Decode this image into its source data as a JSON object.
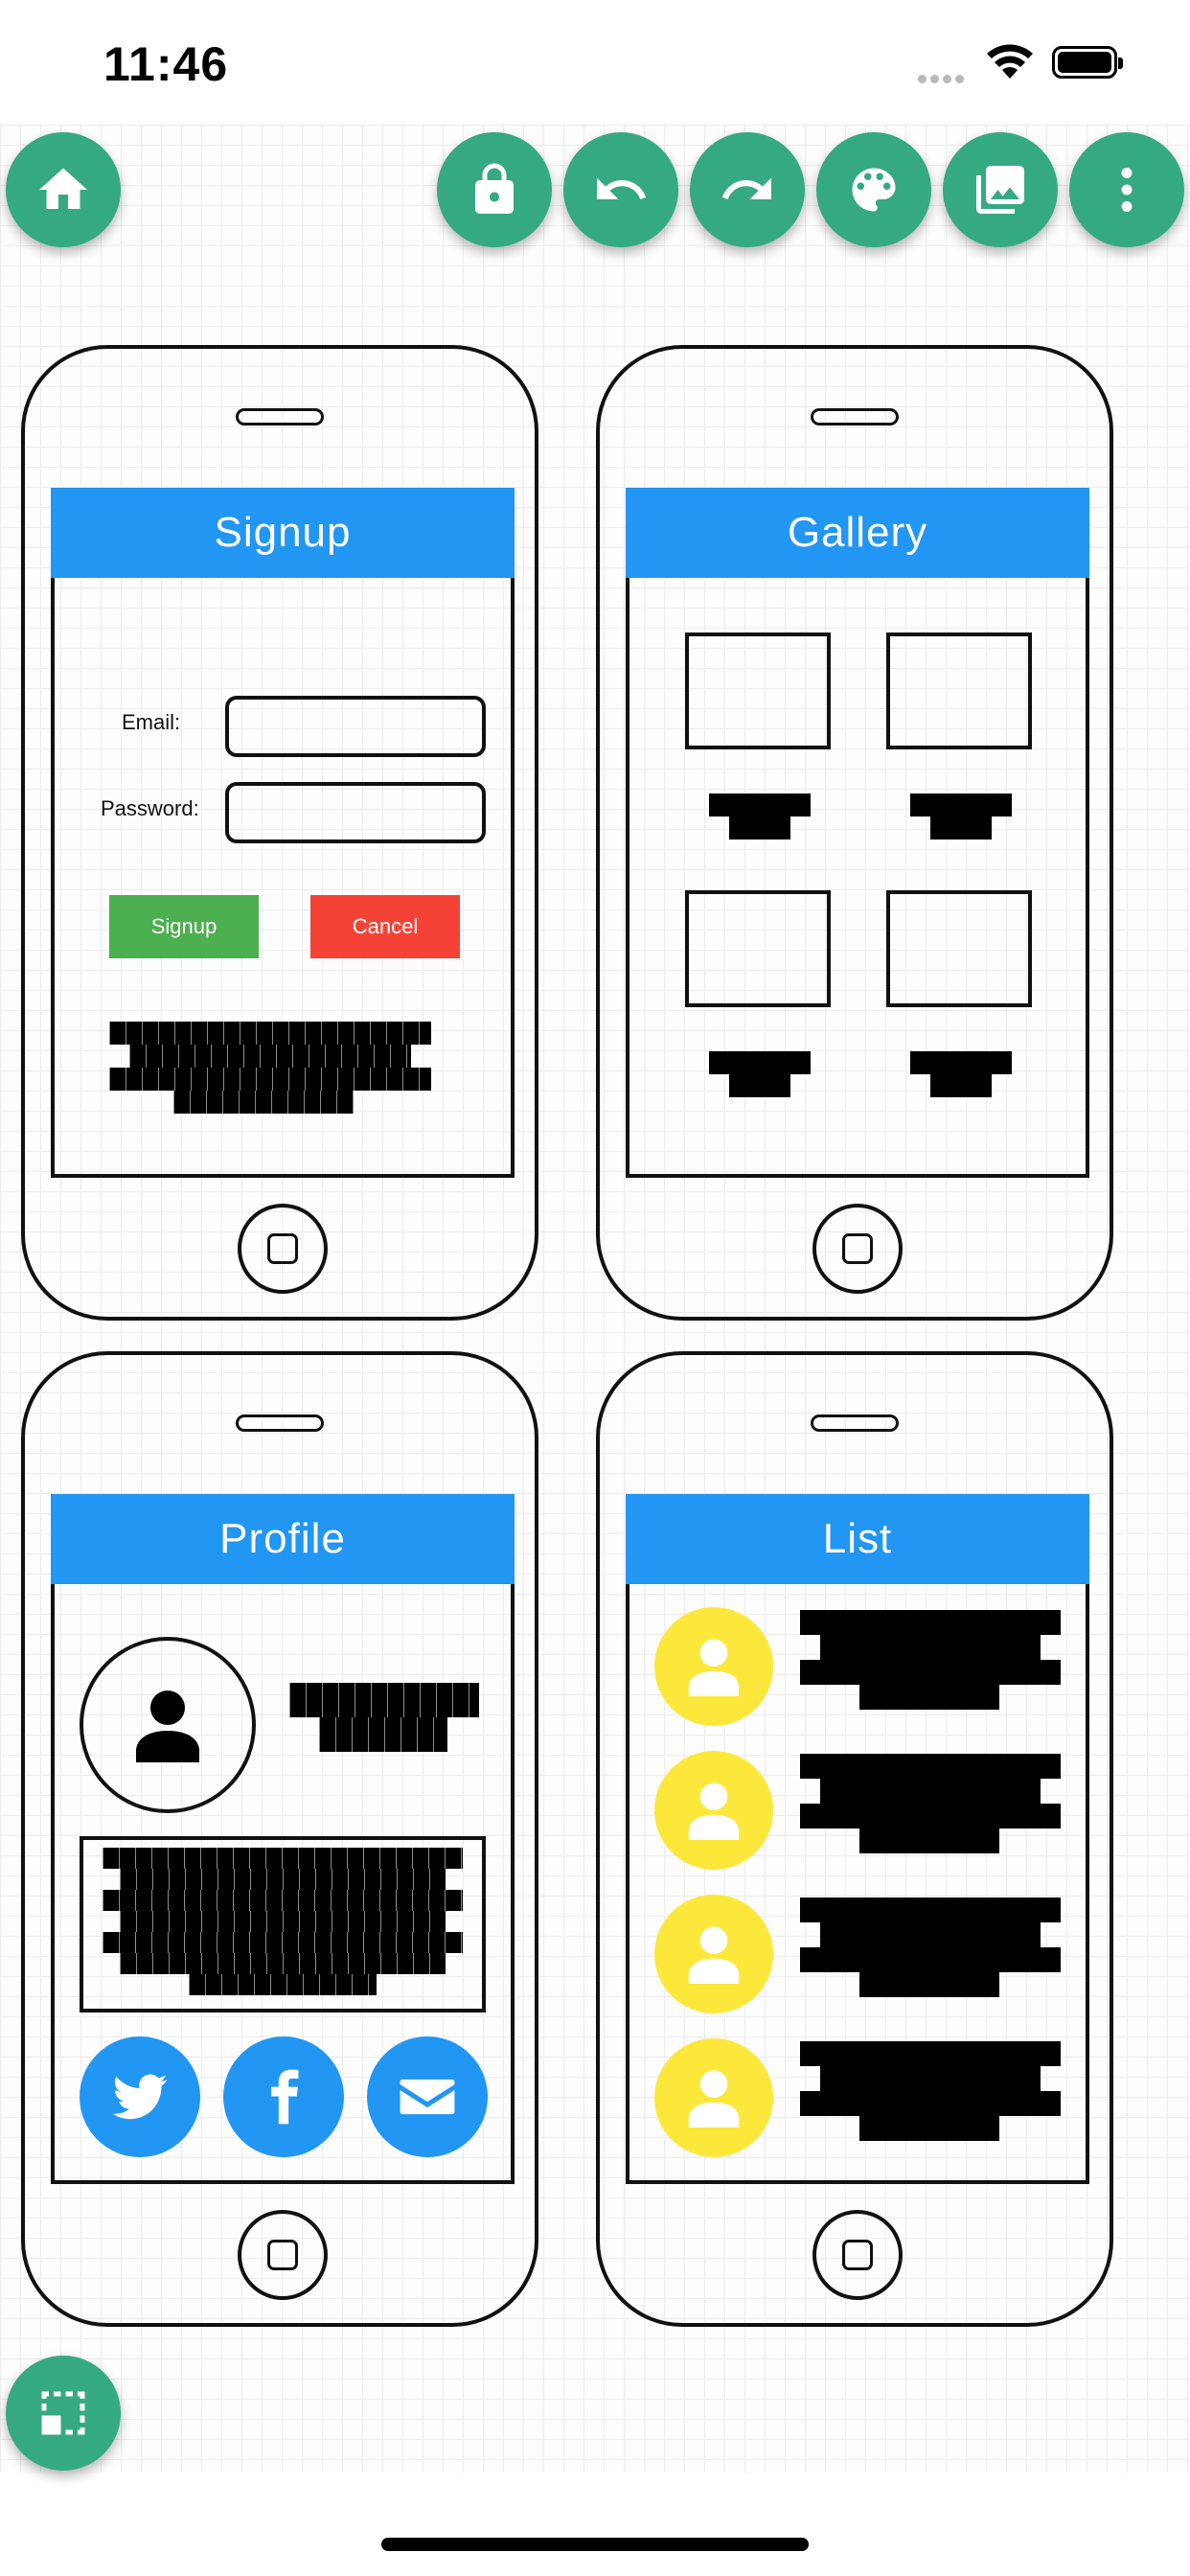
{
  "status_bar": {
    "time": "11:46"
  },
  "toolbar": {
    "home_icon": "home-icon",
    "lock_icon": "lock-icon",
    "undo_icon": "undo-icon",
    "redo_icon": "redo-icon",
    "palette_icon": "palette-icon",
    "gallery_icon": "image-library-icon",
    "more_icon": "more-vertical-icon"
  },
  "bottom_fab": {
    "icon": "select-area-icon"
  },
  "mockups": {
    "signup": {
      "title": "Signup",
      "email_label": "Email:",
      "password_label": "Password:",
      "signup_button": "Signup",
      "cancel_button": "Cancel"
    },
    "gallery": {
      "title": "Gallery"
    },
    "profile": {
      "title": "Profile"
    },
    "list": {
      "title": "List"
    }
  },
  "colors": {
    "fab": "#35a982",
    "appbar": "#2196f3",
    "signup_button": "#4caf50",
    "cancel_button": "#f44336",
    "list_avatar": "#fce83a"
  }
}
